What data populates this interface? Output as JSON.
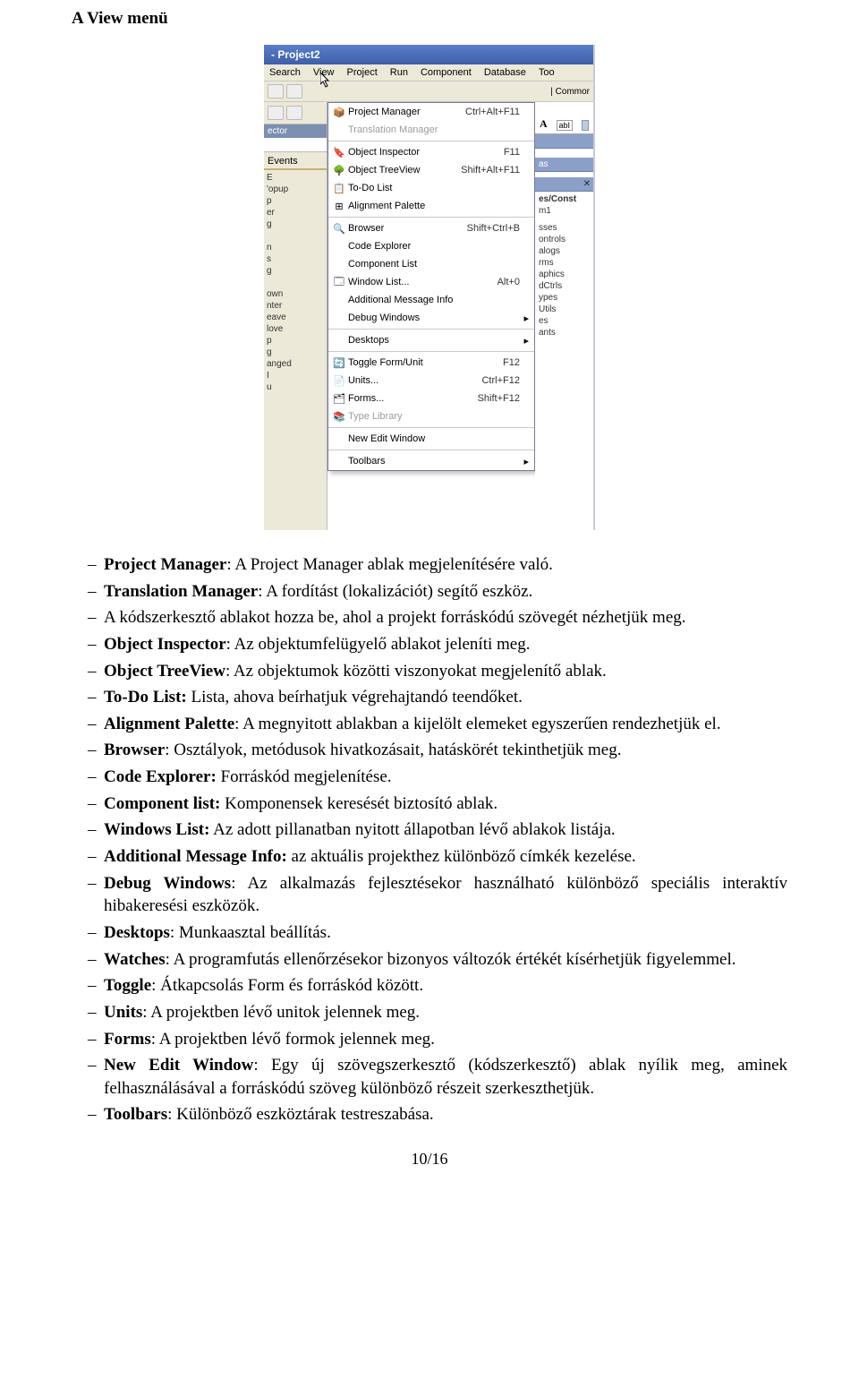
{
  "doc": {
    "title": "A View menü",
    "page_footer": "10/16"
  },
  "app": {
    "titlebar": " - Project2",
    "menubar": [
      "Search",
      "View",
      "Project",
      "Run",
      "Component",
      "Database",
      "Too"
    ],
    "toolbar_right_labels": [
      "|  Commor"
    ],
    "comp_bar": [
      "A",
      "abI"
    ]
  },
  "left_panel": {
    "tab": "ector",
    "events": "Events",
    "items": [
      "E",
      "'opup",
      "p",
      "er",
      "g",
      "",
      "n",
      "s",
      "g",
      "",
      "own",
      "nter",
      "eave",
      "love",
      "p",
      "g",
      "anged",
      "I",
      "u"
    ]
  },
  "right_panel": {
    "as_label": "as",
    "close_x": "✕",
    "group1": "es/Const",
    "group1_item": "m1",
    "items": [
      "sses",
      "ontrols",
      "alogs",
      "rms",
      "aphics",
      "dCtrls",
      "ypes",
      "Utils",
      "es",
      "ants"
    ]
  },
  "view_menu": [
    {
      "icon": "📦",
      "label": "Project Manager",
      "shortcut": "Ctrl+Alt+F11"
    },
    {
      "icon": "",
      "label": "Translation Manager",
      "shortcut": "",
      "disabled": true
    },
    {
      "sep": true
    },
    {
      "icon": "🔖",
      "label": "Object Inspector",
      "shortcut": "F11"
    },
    {
      "icon": "🌳",
      "label": "Object TreeView",
      "shortcut": "Shift+Alt+F11"
    },
    {
      "icon": "📋",
      "label": "To-Do List",
      "shortcut": ""
    },
    {
      "icon": "⊞",
      "label": "Alignment Palette",
      "shortcut": ""
    },
    {
      "sep": true
    },
    {
      "icon": "🔍",
      "label": "Browser",
      "shortcut": "Shift+Ctrl+B"
    },
    {
      "icon": "",
      "label": "Code Explorer",
      "shortcut": ""
    },
    {
      "icon": "",
      "label": "Component List",
      "shortcut": ""
    },
    {
      "icon": "🗔",
      "label": "Window List...",
      "shortcut": "Alt+0"
    },
    {
      "icon": "",
      "label": "Additional Message Info",
      "shortcut": ""
    },
    {
      "icon": "",
      "label": "Debug Windows",
      "shortcut": "",
      "arrow": true
    },
    {
      "sep": true
    },
    {
      "icon": "",
      "label": "Desktops",
      "shortcut": "",
      "arrow": true
    },
    {
      "sep": true
    },
    {
      "icon": "🔄",
      "label": "Toggle Form/Unit",
      "shortcut": "F12"
    },
    {
      "icon": "📄",
      "label": "Units...",
      "shortcut": "Ctrl+F12"
    },
    {
      "icon": "🗂",
      "label": "Forms...",
      "shortcut": "Shift+F12"
    },
    {
      "icon": "📚",
      "label": "Type Library",
      "shortcut": "",
      "disabled": true
    },
    {
      "sep": true
    },
    {
      "icon": "",
      "label": "New Edit Window",
      "shortcut": ""
    },
    {
      "sep": true
    },
    {
      "icon": "",
      "label": "Toolbars",
      "shortcut": "",
      "arrow": true
    }
  ],
  "definitions": [
    {
      "term": "Project Manager",
      "text": ": A Project Manager ablak megjelenítésére való."
    },
    {
      "term": "Translation Manager",
      "text": ": A fordítást (lokalizációt) segítő eszköz."
    },
    {
      "term": "",
      "text": "A kódszerkesztő ablakot hozza be, ahol a projekt forráskódú szövegét nézhetjük meg."
    },
    {
      "term": "Object Inspector",
      "text": ": Az objektumfelügyelő ablakot jeleníti meg."
    },
    {
      "term": "Object TreeView",
      "text": ": Az objektumok közötti viszonyokat megjelenítő ablak."
    },
    {
      "term": "To-Do List:",
      "text": " Lista, ahova beírhatjuk végrehajtandó teendőket."
    },
    {
      "term": "Alignment Palette",
      "text": ": A megnyitott ablakban a kijelölt elemeket egyszerűen rendezhetjük el."
    },
    {
      "term": "Browser",
      "text": ": Osztályok, metódusok hivatkozásait, hatáskörét tekinthetjük meg."
    },
    {
      "term": "Code Explorer:",
      "text": " Forráskód megjelenítése."
    },
    {
      "term": "Component list:",
      "text": " Komponensek keresését biztosító ablak."
    },
    {
      "term": "Windows List:",
      "text": " Az adott pillanatban nyitott állapotban lévő ablakok listája."
    },
    {
      "term": "Additional Message Info:",
      "text": " az aktuális projekthez különböző címkék kezelése."
    },
    {
      "term": "Debug Windows",
      "text": ": Az alkalmazás fejlesztésekor használható különböző speciális interaktív hibakeresési eszközök."
    },
    {
      "term": "Desktops",
      "text": ": Munkaasztal beállítás."
    },
    {
      "term": "Watches",
      "text": ": A programfutás ellenőrzésekor bizonyos változók értékét kísérhetjük figyelemmel."
    },
    {
      "term": "Toggle",
      "text": ": Átkapcsolás Form és forráskód között."
    },
    {
      "term": "Units",
      "text": ": A projektben lévő unitok jelennek meg."
    },
    {
      "term": "Forms",
      "text": ": A projektben lévő formok jelennek meg."
    },
    {
      "term": "New Edit Window",
      "text": ": Egy új szövegszerkesztő (kódszerkesztő) ablak nyílik meg, aminek felhasználásával a forráskódú szöveg különböző részeit szerkeszthetjük."
    },
    {
      "term": "Toolbars",
      "text": ": Különböző eszköztárak testreszabása."
    }
  ]
}
